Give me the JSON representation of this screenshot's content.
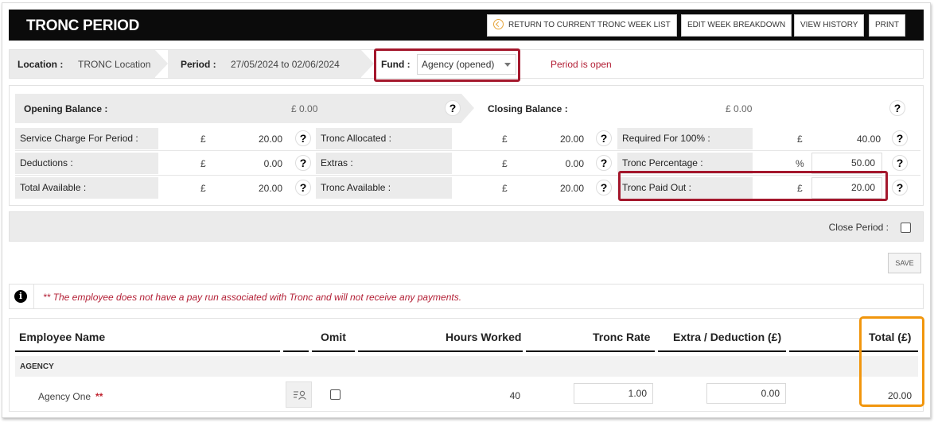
{
  "header": {
    "title": "TRONC PERIOD",
    "buttons": {
      "return": "RETURN TO CURRENT TRONC WEEK LIST",
      "edit": "EDIT WEEK BREAKDOWN",
      "history": "VIEW HISTORY",
      "print": "PRINT"
    }
  },
  "location_bar": {
    "location_label": "Location :",
    "location_value": "TRONC Location",
    "period_label": "Period :",
    "period_value": "27/05/2024 to 02/06/2024",
    "fund_label": "Fund :",
    "fund_value": "Agency (opened)",
    "status": "Period is open"
  },
  "balances": {
    "opening_label": "Opening Balance :",
    "opening_value": "£ 0.00",
    "closing_label": "Closing Balance :",
    "closing_value": "£ 0.00",
    "help": "?",
    "rows": [
      {
        "c1": {
          "label": "Service Charge For Period :",
          "sym": "£",
          "value": "20.00"
        },
        "c2": {
          "label": "Tronc Allocated :",
          "sym": "£",
          "value": "20.00"
        },
        "c3": {
          "label": "Required For 100% :",
          "sym": "£",
          "value": "40.00"
        }
      },
      {
        "c1": {
          "label": "Deductions :",
          "sym": "£",
          "value": "0.00"
        },
        "c2": {
          "label": "Extras :",
          "sym": "£",
          "value": "0.00"
        },
        "c3": {
          "label": "Tronc Percentage :",
          "sym": "%",
          "value": "50.00"
        }
      },
      {
        "c1": {
          "label": "Total Available :",
          "sym": "£",
          "value": "20.00"
        },
        "c2": {
          "label": "Tronc Available :",
          "sym": "£",
          "value": "20.00"
        },
        "c3": {
          "label": "Tronc Paid Out :",
          "sym": "£",
          "value": "20.00"
        }
      }
    ]
  },
  "close_period": {
    "label": "Close Period :"
  },
  "save_label": "SAVE",
  "warning": {
    "icon": "i",
    "text": "** The employee does not have a pay run associated with Tronc and will not receive any payments."
  },
  "table": {
    "headers": {
      "name": "Employee Name",
      "omit": "Omit",
      "hours": "Hours Worked",
      "rate": "Tronc Rate",
      "extra": "Extra / Deduction (£)",
      "total": "Total (£)"
    },
    "group": "AGENCY",
    "rows": [
      {
        "name": "Agency One",
        "marker": "**",
        "hours": "40",
        "rate": "1.00",
        "extra": "0.00",
        "total": "20.00"
      }
    ]
  },
  "colors": {
    "highlight_red": "#a4172c",
    "highlight_orange": "#f1960d",
    "status_red": "#b32036",
    "header_bg": "#0b0b0b"
  }
}
